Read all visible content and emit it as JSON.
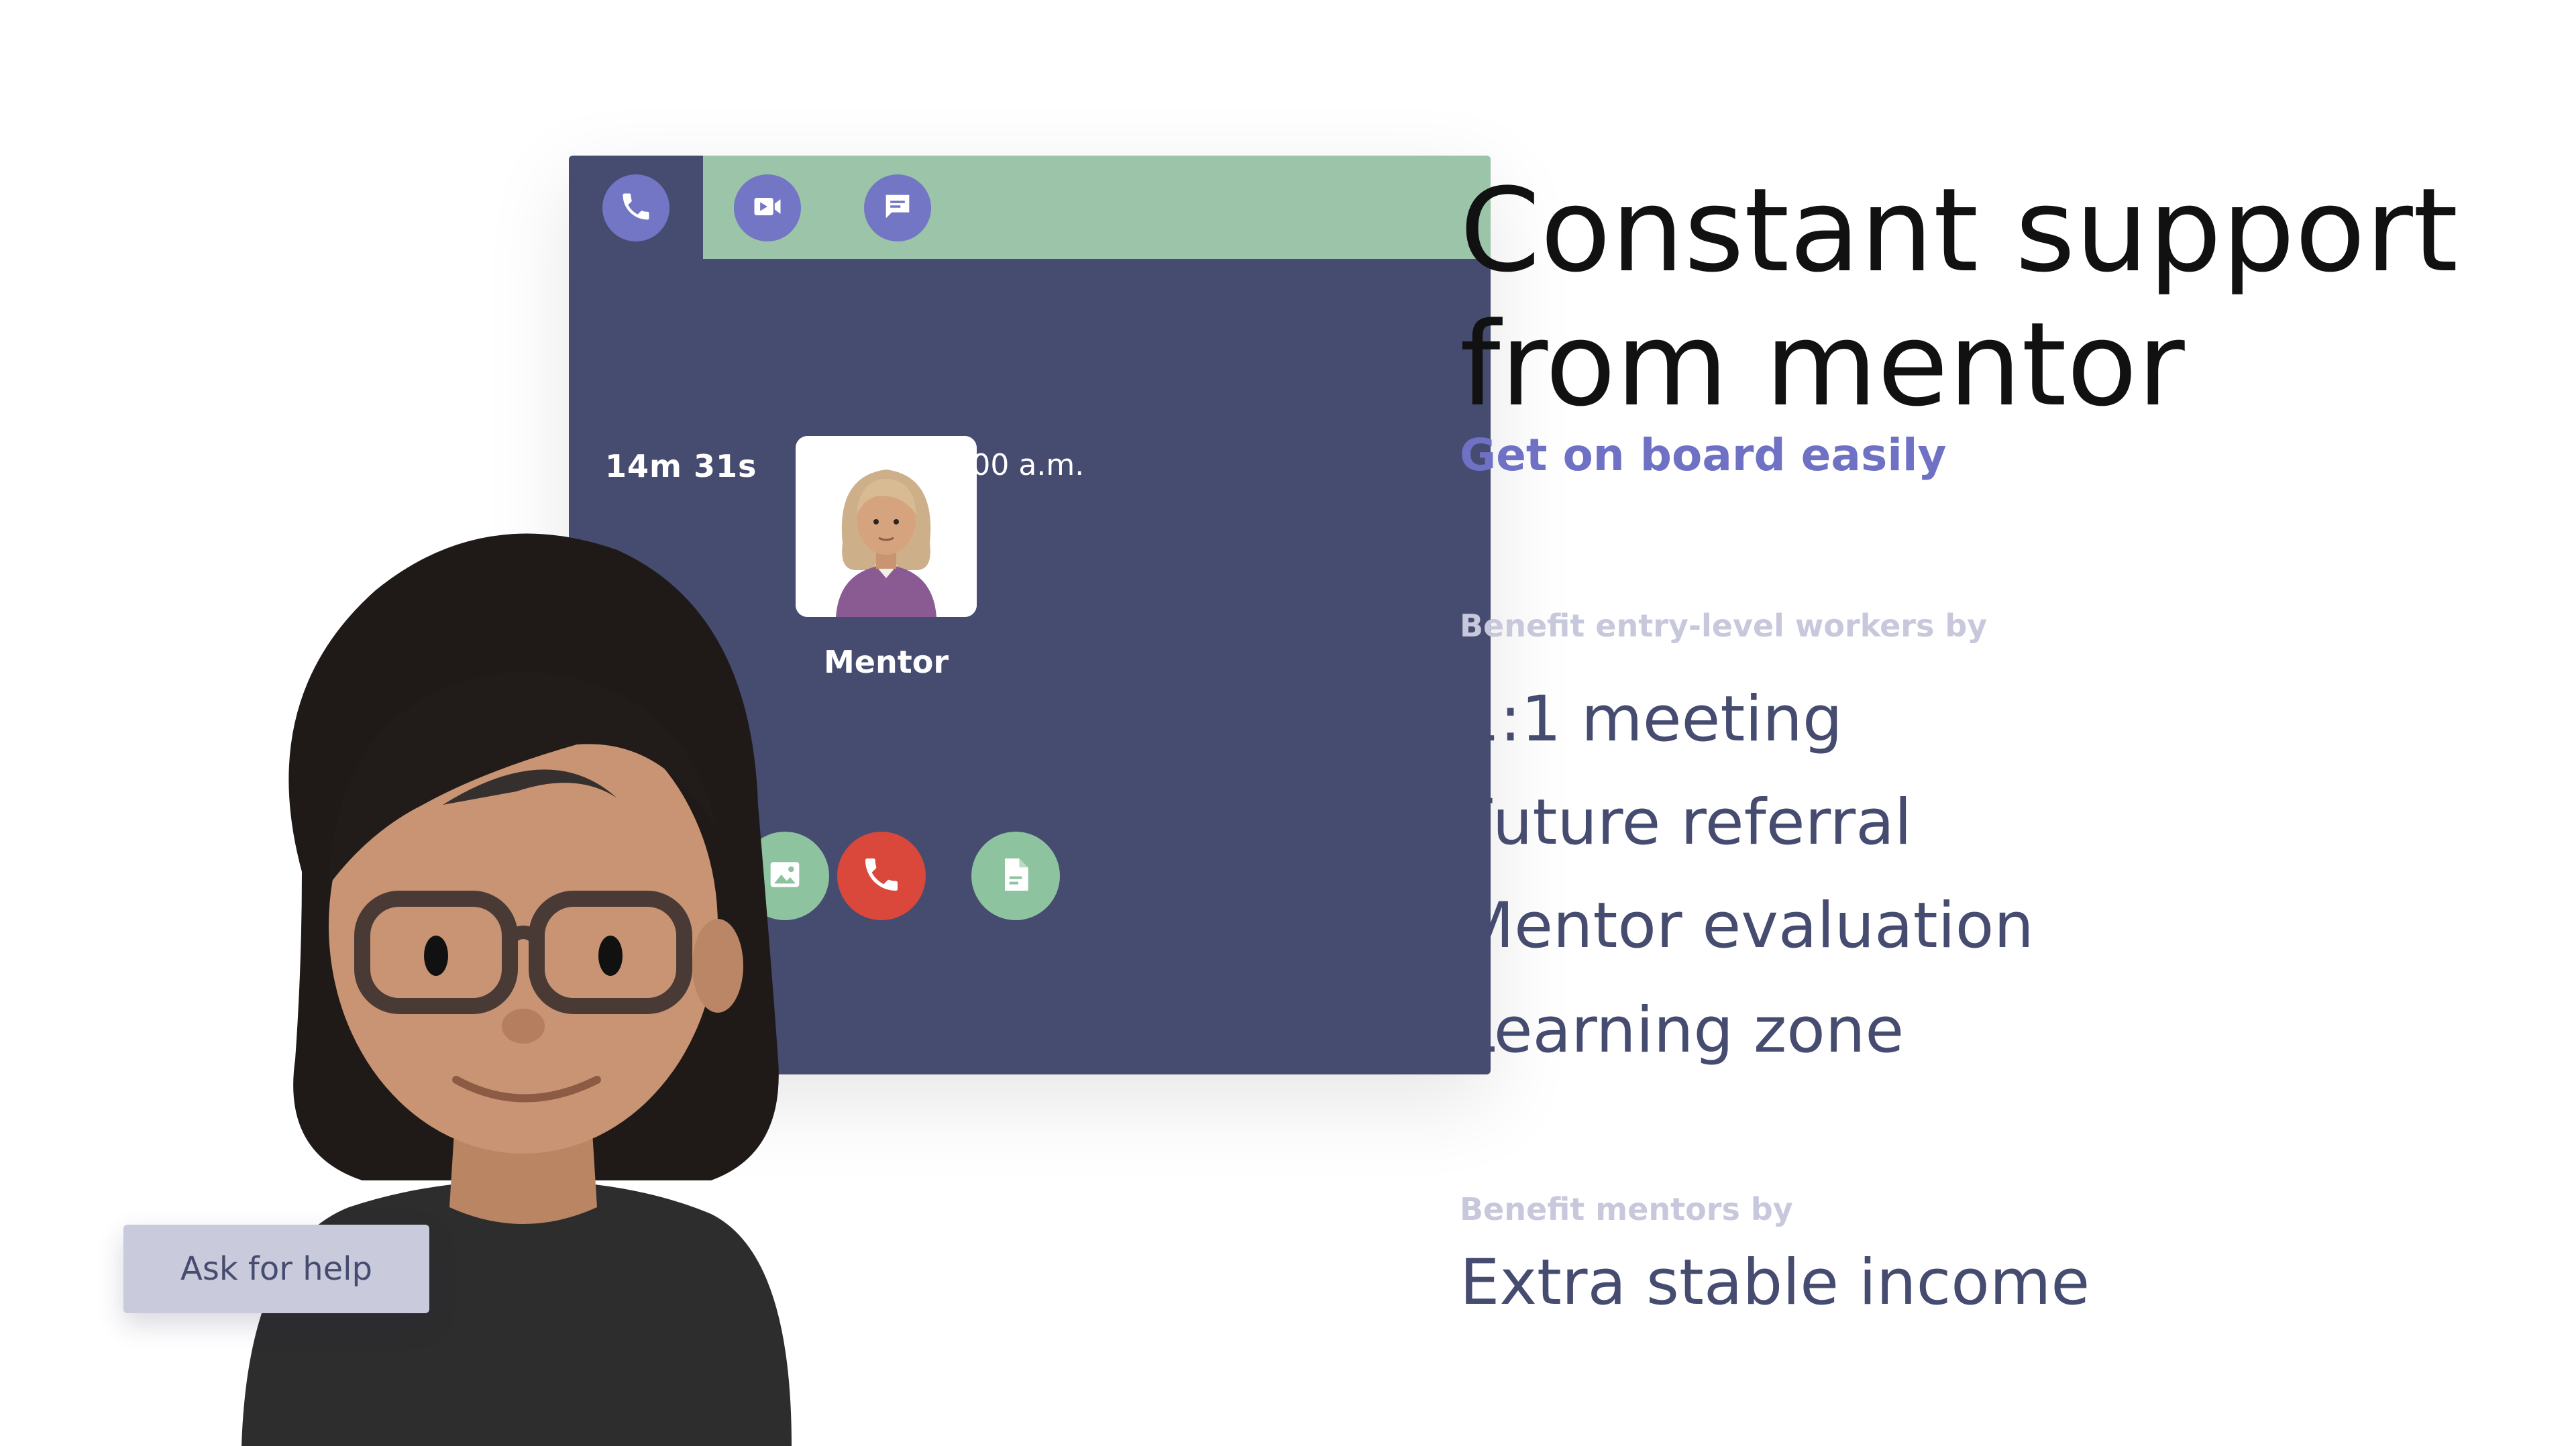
{
  "call_panel": {
    "tabs": [
      {
        "icon": "phone-icon",
        "active": true
      },
      {
        "icon": "video-icon",
        "active": false
      },
      {
        "icon": "chat-icon",
        "active": false
      }
    ],
    "timer": "14m 31s",
    "starts_text": "starts at 9:00 a.m.",
    "mentor_label": "Mentor",
    "actions": [
      {
        "icon": "image-icon"
      },
      {
        "icon": "hang-up-icon"
      },
      {
        "icon": "document-icon"
      }
    ]
  },
  "ask_help_label": "Ask for help",
  "headline": {
    "line1": "Constant support",
    "line2": "from mentor"
  },
  "subhead": "Get on board easily",
  "workers_section": {
    "label": "Benefit entry-level workers by",
    "items": [
      "1:1 meeting",
      "Future referral",
      "Mentor evaluation",
      "Learning zone"
    ]
  },
  "mentors_section": {
    "label": "Benefit mentors by",
    "items": [
      "Extra stable income"
    ]
  },
  "colors": {
    "panel_bg": "#464b70",
    "tab_bar": "#9bc4a8",
    "tab_icon_bg": "#7276c4",
    "accent_purple": "#6f71c4",
    "hangup_red": "#d9483b",
    "action_green": "#8ec39f",
    "benefit_text": "#464b70",
    "label_text": "#c7c8dc"
  }
}
